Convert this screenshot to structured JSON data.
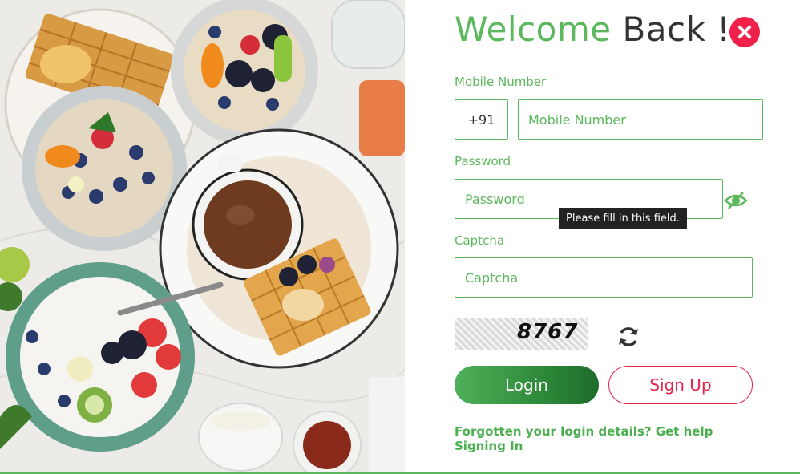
{
  "title": {
    "part1": "Welcome",
    "part2": "Back !"
  },
  "mobile": {
    "label": "Mobile Number",
    "country_code": "+91",
    "placeholder": "Mobile Number"
  },
  "password": {
    "label": "Password",
    "placeholder": "Password",
    "tooltip": "Please fill in this field."
  },
  "captcha": {
    "label": "Captcha",
    "placeholder": "Captcha",
    "code": "8767"
  },
  "buttons": {
    "login": "Login",
    "signup": "Sign Up"
  },
  "help_link": "Forgotten your login details? Get help Signing In",
  "colors": {
    "accent": "#5cb85c",
    "danger": "#f0224b",
    "login_dark": "#1e6b2a"
  },
  "icons": {
    "close": "close-icon",
    "eye": "eye-toggle-icon",
    "refresh": "refresh-icon"
  }
}
